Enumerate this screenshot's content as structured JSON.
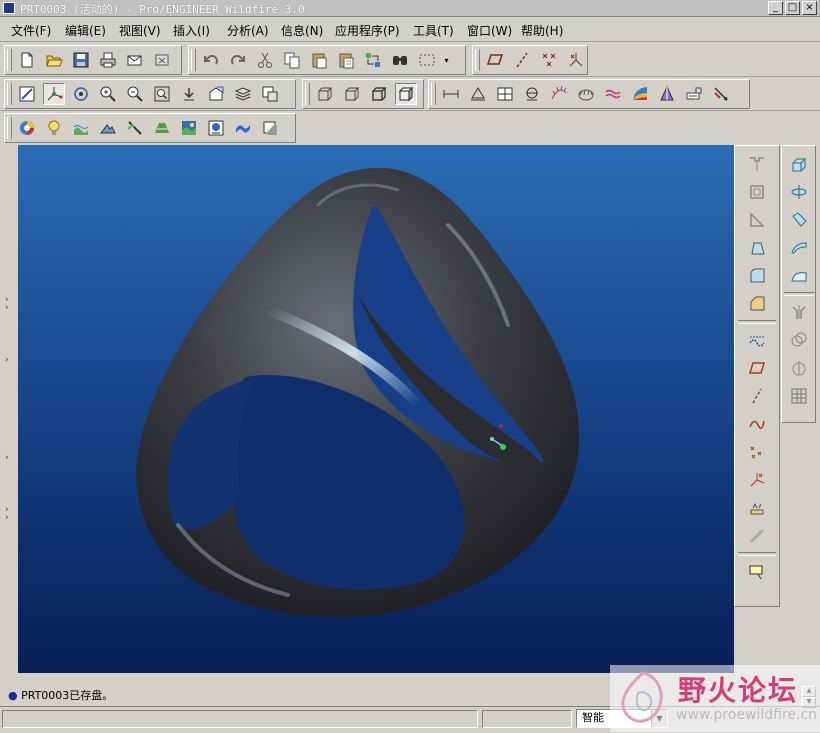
{
  "window": {
    "title": "PRT0003 (活动的) - Pro/ENGINEER Wildfire 3.0",
    "min_label": "_",
    "max_label": "□",
    "close_label": "×"
  },
  "menu": [
    {
      "label": "文件(F)"
    },
    {
      "label": "编辑(E)"
    },
    {
      "label": "视图(V)"
    },
    {
      "label": "插入(I)"
    },
    {
      "label": "分析(A)"
    },
    {
      "label": "信息(N)"
    },
    {
      "label": "应用程序(P)"
    },
    {
      "label": "工具(T)"
    },
    {
      "label": "窗口(W)"
    },
    {
      "label": "帮助(H)"
    }
  ],
  "toolbar_icons": {
    "file": [
      "new-file-icon",
      "open-folder-icon",
      "save-icon",
      "print-icon",
      "send-mail-icon",
      "close-window-icon"
    ],
    "edit": [
      "undo-icon",
      "redo-icon",
      "cut-icon",
      "copy-icon",
      "paste-icon",
      "paste-special-icon",
      "regenerate-icon",
      "find-icon",
      "select-box-icon"
    ],
    "datum": [
      "plane-display-icon",
      "axis-display-icon",
      "point-display-icon",
      "csys-display-icon"
    ],
    "view": [
      "repaint-icon",
      "spin-center-icon",
      "orient-mode-icon",
      "zoom-in-icon",
      "zoom-out-icon",
      "refit-icon",
      "reorient-icon",
      "saved-views-icon",
      "layers-icon",
      "view-manager-icon"
    ],
    "display": [
      "wireframe-icon",
      "hidden-line-icon",
      "no-hidden-icon",
      "shading-icon"
    ],
    "analysis": [
      "measure-distance-icon",
      "measure-area-icon",
      "model-analysis-icon",
      "section-analysis-icon",
      "curvature-icon",
      "dihedral-icon",
      "offset-analysis-icon",
      "shaded-curvature-icon",
      "draft-analysis-icon",
      "reflection-icon",
      "slope-icon"
    ],
    "render": [
      "color-appearance-icon",
      "light-icon",
      "environment-icon",
      "scene-icon",
      "texture-icon",
      "room-icon",
      "render-icon",
      "spotlight-icon",
      "deform-icon",
      "model-tree-toggle-icon"
    ],
    "right_inner": [
      "hole-tool-icon",
      "shell-tool-icon",
      "rib-tool-icon",
      "draft-tool-icon",
      "round-tool-icon",
      "chamfer-tool-icon",
      "sketch-icon",
      "datum-plane-icon",
      "datum-axis-icon",
      "datum-curve-icon",
      "datum-point-icon",
      "datum-csys-icon",
      "analysis-feature-icon",
      "note-icon"
    ],
    "right_outer": [
      "extrude-tool-icon",
      "revolve-tool-icon",
      "variable-sweep-icon",
      "boundary-blend-icon",
      "style-icon",
      "mirror-tool-icon",
      "merge-tool-icon",
      "trim-tool-icon",
      "pattern-tool-icon"
    ]
  },
  "status": {
    "message": "PRT0003已存盘。",
    "filter_value": "智能"
  },
  "watermark": {
    "logo_text": "野火论坛",
    "url_text": "www.proewildfire.cn"
  },
  "colors": {
    "viewport_top": "#2b6db4",
    "viewport_bottom": "#081f55",
    "model": "#3a3c40",
    "chrome": "#d4d0c8"
  }
}
